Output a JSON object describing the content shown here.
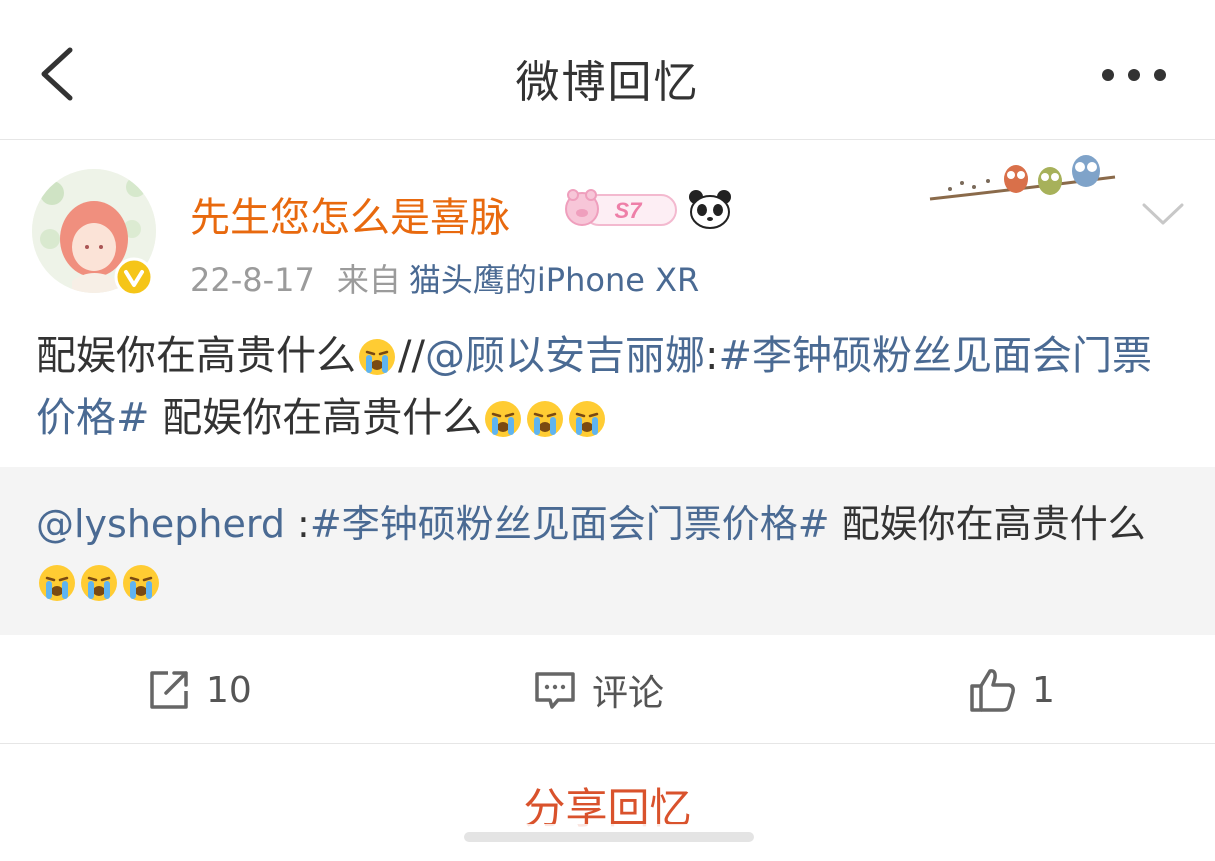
{
  "navbar": {
    "title": "微博回忆",
    "back_icon": "chevron-left-icon",
    "more_icon": "more-horizontal-icon"
  },
  "post": {
    "author": {
      "name": "先生您怎么是喜脉",
      "level_badge": "S7",
      "verified_icon": "verified-v-icon"
    },
    "meta": {
      "date": "22-8-17",
      "from_label": "来自",
      "device": "猫头鹰的iPhone XR"
    },
    "content": {
      "part1": "配娱你在高贵什么",
      "part2": "//",
      "mention": "@顾以安吉丽娜",
      "colon": ":",
      "topic": "#李钟硕粉丝见面会门票价格#",
      "part3": " 配娱你在高贵什么"
    },
    "quote": {
      "mention": "@lyshepherd",
      "colon": " :",
      "topic": "#李钟硕粉丝见面会门票价格#",
      "text": " 配娱你在高贵什么"
    },
    "actions": {
      "repost_count": "10",
      "comment_label": "评论",
      "like_count": "1"
    }
  },
  "share": {
    "label": "分享回忆"
  },
  "colors": {
    "username": "#e8690e",
    "link": "#4a6a93",
    "share": "#d9522c",
    "quote_bg": "#f4f4f4"
  }
}
